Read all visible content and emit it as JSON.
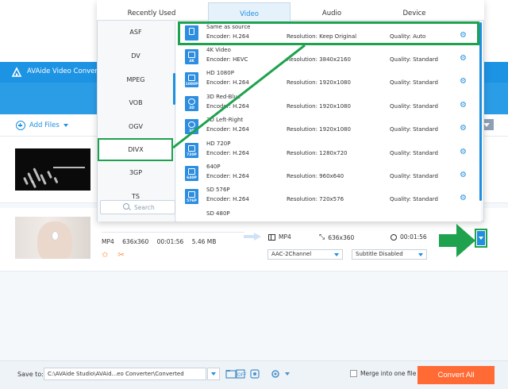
{
  "app": {
    "title": "AVAide Video Converter (",
    "add_files_label": "Add Files"
  },
  "popup": {
    "tabs": [
      {
        "label": "Recently Used"
      },
      {
        "label": "Video"
      },
      {
        "label": "Audio"
      },
      {
        "label": "Device"
      }
    ],
    "categories": [
      {
        "label": "ASF"
      },
      {
        "label": "DV"
      },
      {
        "label": "MPEG"
      },
      {
        "label": "VOB"
      },
      {
        "label": "OGV"
      },
      {
        "label": "DIVX"
      },
      {
        "label": "3GP"
      },
      {
        "label": "TS"
      }
    ],
    "search_label": "Search",
    "formats": [
      {
        "name": "Same as source",
        "icon_label": "",
        "encoder": "Encoder: H.264",
        "resolution": "Resolution: Keep Original",
        "quality": "Quality: Auto"
      },
      {
        "name": "4K Video",
        "icon_label": "4K",
        "encoder": "Encoder: HEVC",
        "resolution": "Resolution: 3840x2160",
        "quality": "Quality: Standard"
      },
      {
        "name": "HD 1080P",
        "icon_label": "1080P",
        "encoder": "Encoder: H.264",
        "resolution": "Resolution: 1920x1080",
        "quality": "Quality: Standard"
      },
      {
        "name": "3D Red-Blue",
        "icon_label": "3D",
        "encoder": "Encoder: H.264",
        "resolution": "Resolution: 1920x1080",
        "quality": "Quality: Standard"
      },
      {
        "name": "3D Left-Right",
        "icon_label": "3D",
        "encoder": "Encoder: H.264",
        "resolution": "Resolution: 1920x1080",
        "quality": "Quality: Standard"
      },
      {
        "name": "HD 720P",
        "icon_label": "720P",
        "encoder": "Encoder: H.264",
        "resolution": "Resolution: 1280x720",
        "quality": "Quality: Standard"
      },
      {
        "name": "640P",
        "icon_label": "640P",
        "encoder": "Encoder: H.264",
        "resolution": "Resolution: 960x640",
        "quality": "Quality: Standard"
      },
      {
        "name": "SD 576P",
        "icon_label": "576P",
        "encoder": "Encoder: H.264",
        "resolution": "Resolution: 720x576",
        "quality": "Quality: Standard"
      },
      {
        "name": "SD 480P",
        "icon_label": "",
        "encoder": "",
        "resolution": "",
        "quality": ""
      }
    ]
  },
  "file": {
    "format": "MP4",
    "resolution": "636x360",
    "duration": "00:01:56",
    "size": "5.46 MB",
    "output_format": "MP4",
    "output_resolution": "636x360",
    "output_duration": "00:01:56",
    "audio_track": "AAC-2Channel",
    "subtitle": "Subtitle Disabled"
  },
  "footer": {
    "save_to_label": "Save to:",
    "save_path": "C:\\AVAide Studio\\AVAid...eo Converter\\Converted",
    "merge_label": "Merge into one file",
    "convert_all_label": "Convert All"
  },
  "colors": {
    "accent_blue": "#1f8fde",
    "titlebar_blue": "#1d93e3",
    "highlight_green": "#1ea24d",
    "convert_orange": "#ff6a35"
  }
}
